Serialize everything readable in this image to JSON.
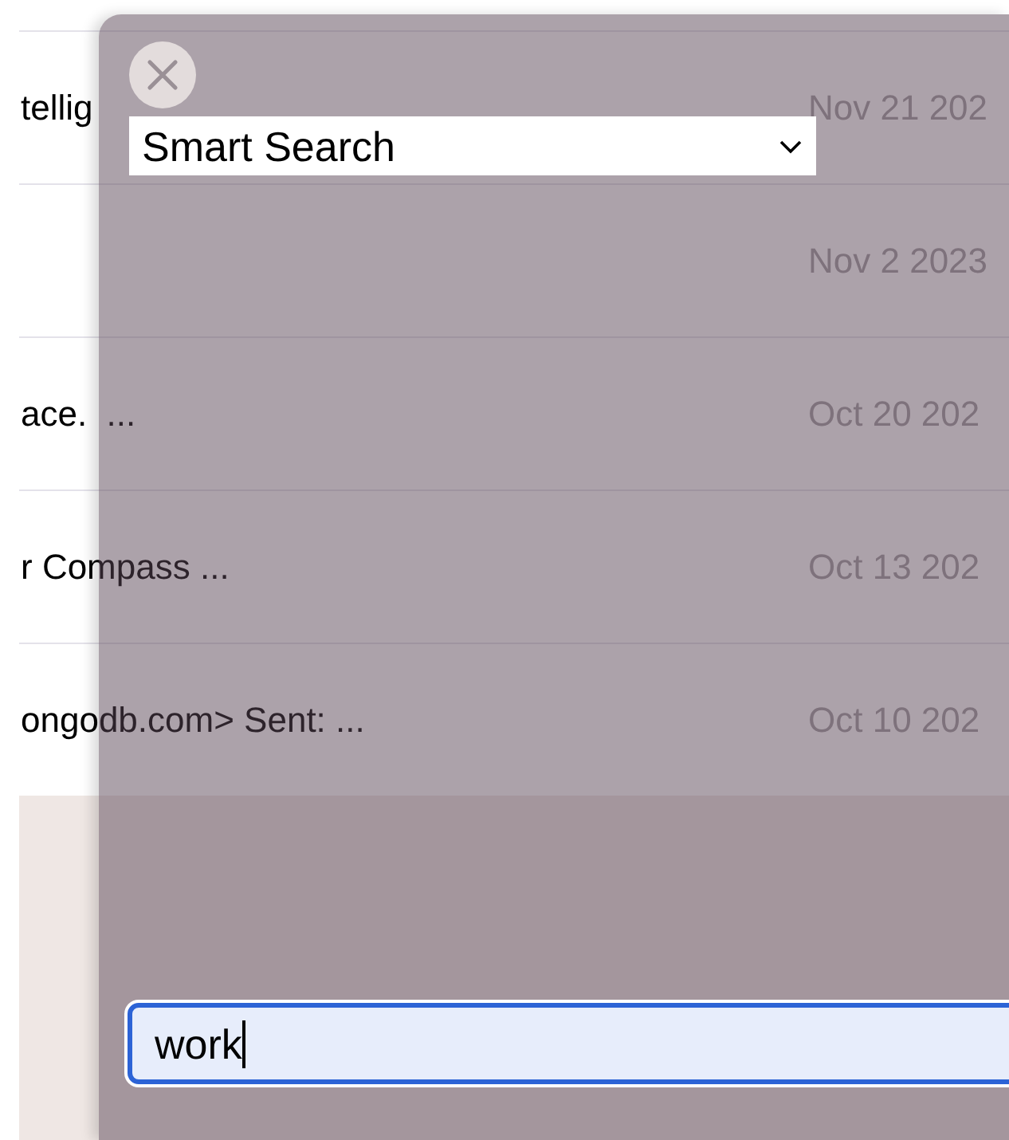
{
  "messages": [
    {
      "snippet": "tellig",
      "date": "Nov 21 202"
    },
    {
      "date": "Nov 2 2023"
    },
    {
      "snippet": "ace.  ...",
      "date": "Oct 20 202"
    },
    {
      "snippet": "r Compass ...",
      "date": "Oct 13 202"
    },
    {
      "snippet": "ongodb.com> Sent: ...",
      "date": "Oct 10 202"
    }
  ],
  "search_panel": {
    "mode_select": {
      "value": "Smart Search"
    },
    "query": {
      "value": "work"
    }
  }
}
